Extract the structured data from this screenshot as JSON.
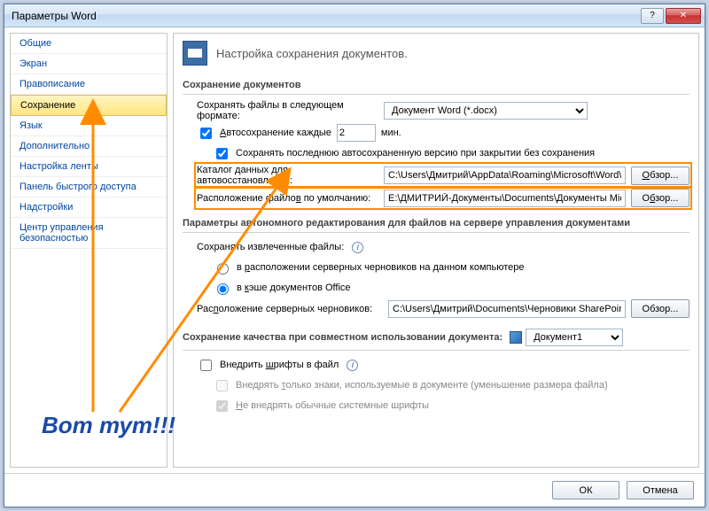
{
  "window": {
    "title": "Параметры Word"
  },
  "sidebar": {
    "items": [
      {
        "label": "Общие"
      },
      {
        "label": "Экран"
      },
      {
        "label": "Правописание"
      },
      {
        "label": "Сохранение",
        "selected": true
      },
      {
        "label": "Язык"
      },
      {
        "label": "Дополнительно"
      },
      {
        "label": "Настройка ленты"
      },
      {
        "label": "Панель быстрого доступа"
      },
      {
        "label": "Надстройки"
      },
      {
        "label": "Центр управления безопасностью"
      }
    ]
  },
  "header": {
    "text": "Настройка сохранения документов."
  },
  "sections": {
    "save": {
      "title": "Сохранение документов",
      "format_label": "Сохранять файлы в следующем формате:",
      "format_value": "Документ Word (*.docx)",
      "autosave_label": "Автосохранение каждые",
      "autosave_value": "2",
      "autosave_unit": "мин.",
      "keep_last_label": "Сохранять последнюю автосохраненную версию при закрытии без сохранения",
      "autorecover_label": "Каталог данных для автовосстановления:",
      "autorecover_value": "C:\\Users\\Дмитрий\\AppData\\Roaming\\Microsoft\\Word\\",
      "default_loc_label": "Расположение файлов по умолчанию:",
      "default_loc_value": "E:\\ДМИТРИЙ-Документы\\Documents\\Документы Microsoft Word",
      "browse": "Обзор..."
    },
    "offline": {
      "title": "Параметры автономного редактирования для файлов на сервере управления документами",
      "save_checked_label": "Сохранять извлеченные файлы:",
      "opt_server_drafts": "в расположении серверных черновиков на данном компьютере",
      "opt_office_cache": "в кэше документов Office",
      "drafts_label": "Расположение серверных черновиков:",
      "drafts_value": "C:\\Users\\Дмитрий\\Documents\\Черновики SharePoint\\",
      "browse": "Обзор..."
    },
    "fidelity": {
      "title": "Сохранение качества при совместном использовании документа:",
      "doc_value": "Документ1",
      "embed_fonts": "Внедрить шрифты в файл",
      "embed_used_only": "Внедрять только знаки, используемые в документе (уменьшение размера файла)",
      "no_system_fonts": "Не внедрять обычные системные шрифты"
    }
  },
  "footer": {
    "ok": "ОК",
    "cancel": "Отмена"
  },
  "annotation": {
    "caption": "Вот тут!!!"
  }
}
